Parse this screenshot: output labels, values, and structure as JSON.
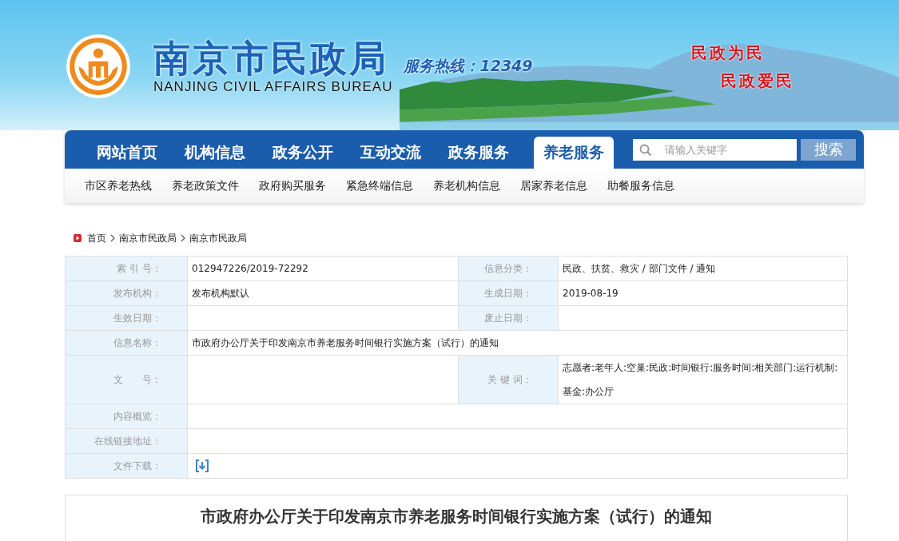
{
  "header": {
    "title": "南京市民政局",
    "subtitle": "NANJING CIVIL AFFAIRS BUREAU",
    "hotline": "服务热线：12349",
    "slogans": [
      "民政为民",
      "民政爱民"
    ]
  },
  "nav": {
    "items": [
      {
        "label": "网站首页",
        "selected": false
      },
      {
        "label": "机构信息",
        "selected": false
      },
      {
        "label": "政务公开",
        "selected": false
      },
      {
        "label": "互动交流",
        "selected": false
      },
      {
        "label": "政务服务",
        "selected": false
      },
      {
        "label": "养老服务",
        "selected": true
      }
    ],
    "search": {
      "placeholder": "请输入关键字",
      "button": "搜索"
    }
  },
  "subnav": [
    "市区养老热线",
    "养老政策文件",
    "政府购买服务",
    "紧急终端信息",
    "养老机构信息",
    "居家养老信息",
    "助餐服务信息"
  ],
  "breadcrumb": [
    "首页",
    "南京市民政局",
    "南京市民政局"
  ],
  "info_table": {
    "rows": [
      {
        "kind": "pair",
        "cells": [
          {
            "label": "索 引 号：",
            "value": "012947226/2019-72292"
          },
          {
            "label": "信息分类：",
            "value": "民政、扶贫、救灾 / 部门文件 / 通知"
          }
        ]
      },
      {
        "kind": "pair",
        "cells": [
          {
            "label": "发布机构：",
            "value": "发布机构默认"
          },
          {
            "label": "生成日期：",
            "value": "2019-08-19"
          }
        ]
      },
      {
        "kind": "pair",
        "cells": [
          {
            "label": "生效日期："
          },
          {
            "label": "废止日期："
          }
        ]
      },
      {
        "kind": "full",
        "cells": [
          {
            "label": "信息名称：",
            "value": "市政府办公厅关于印发南京市养老服务时间银行实施方案（试行）的通知"
          }
        ]
      },
      {
        "kind": "tall",
        "cells": [
          {
            "label": "文　　号："
          },
          {
            "label": "关 键 词：",
            "value": "志愿者:老年人:空巢:民政:时间银行:服务时间:相关部门:运行机制:基金:办公厅"
          }
        ]
      },
      {
        "kind": "full",
        "cells": [
          {
            "label": "内容概览："
          }
        ]
      },
      {
        "kind": "full",
        "cells": [
          {
            "label": "在线链接地址："
          }
        ]
      },
      {
        "kind": "download",
        "cells": [
          {
            "label": "文件下载："
          }
        ]
      }
    ]
  },
  "article": {
    "title": "市政府办公厅关于印发南京市养老服务时间银行实施方案（试行）的通知"
  }
}
